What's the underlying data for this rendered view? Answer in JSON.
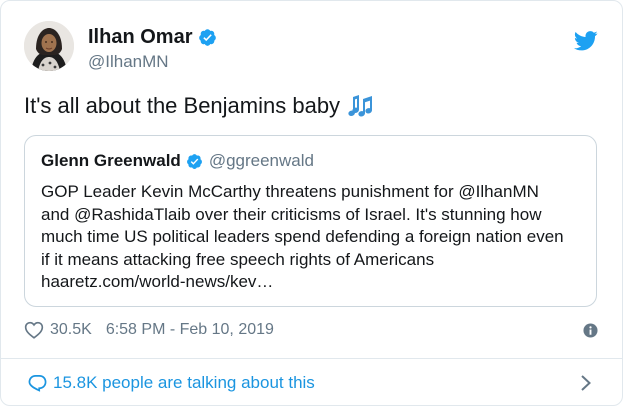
{
  "tweet": {
    "author_name": "Ilhan Omar",
    "author_handle": "@IlhanMN",
    "text": "It's all about the Benjamins baby",
    "text_emoji": "musical-notes-emoji"
  },
  "quoted_tweet": {
    "author_name": "Glenn Greenwald",
    "author_handle": "@ggreenwald",
    "lines": [
      "GOP Leader Kevin McCarthy threatens punishment for @IlhanMN",
      "and @RashidaTlaib over their criticisms of Israel. It's stunning how",
      "much time US political leaders spend defending a foreign nation even",
      "if it means attacking free speech rights of Americans",
      "haaretz.com/world-news/kev…"
    ]
  },
  "stats": {
    "likes": "30.5K",
    "timestamp": "6:58 PM - Feb 10, 2019"
  },
  "footer": {
    "talking_text": "15.8K people are talking about this"
  },
  "colors": {
    "accent": "#1da1f2",
    "link": "#1b95e0",
    "secondary_text": "#657786",
    "border": "#e1e8ed"
  }
}
